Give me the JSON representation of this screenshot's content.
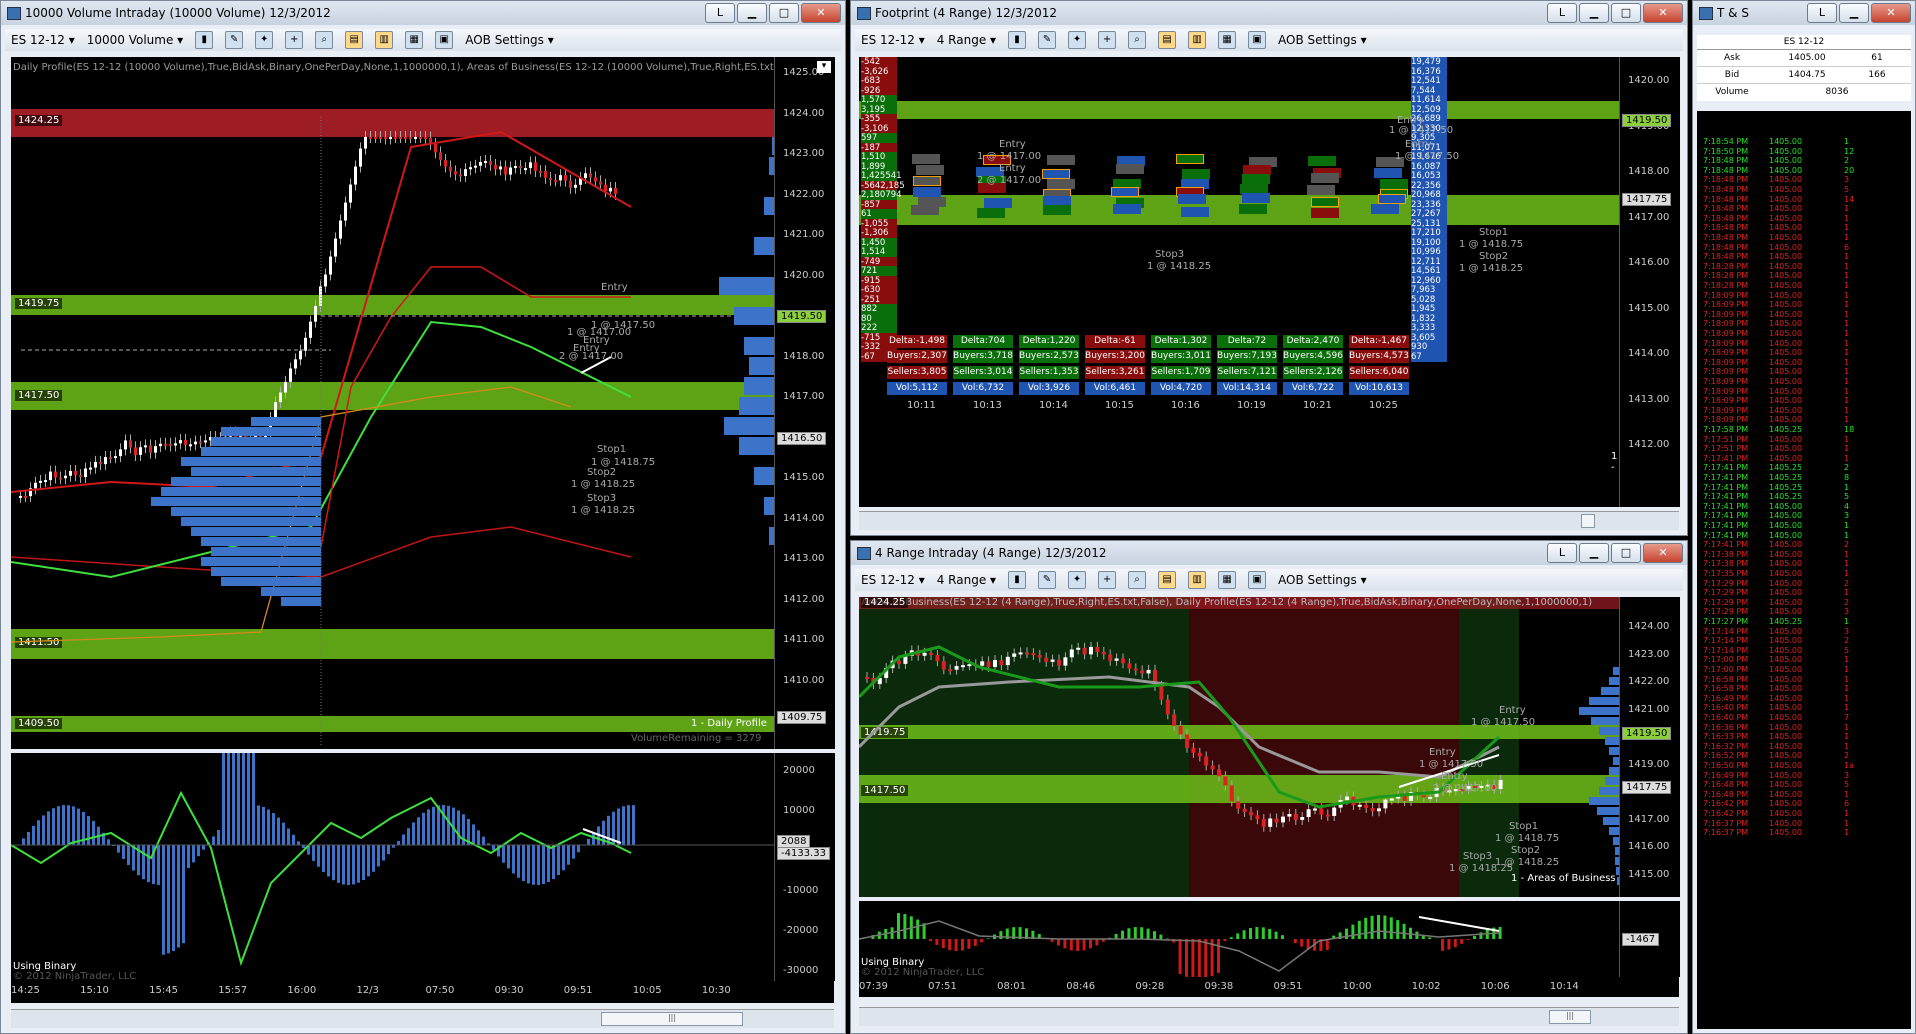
{
  "win1": {
    "title": "10000 Volume Intraday (10000 Volume)  12/3/2012",
    "instrument": "ES 12-12",
    "period": "10000 Volume",
    "aob": "AOB Settings",
    "indicator_text": "Daily Profile(ES 12-12 (10000 Volume),True,BidAsk,Binary,OnePerDay,None,1,1000000,1), Areas of Business(ES 12-12 (10000 Volume),True,Right,ES.txt",
    "prices": [
      "1425.00",
      "1424.00",
      "1423.00",
      "1422.00",
      "1421.00",
      "1420.00",
      "1419.00",
      "1418.00",
      "1417.00",
      "1416.00",
      "1415.00",
      "1414.00",
      "1413.00",
      "1412.00",
      "1411.00",
      "1410.00",
      "1409.00"
    ],
    "levels": [
      "1424.25",
      "1419.75",
      "1417.50",
      "1411.50",
      "1409.50"
    ],
    "tags": [
      "1419.50",
      "1416.50",
      "1409.75"
    ],
    "daily_profile": "1 - Daily Profile",
    "volume_remaining": "VolumeRemaining = 3279",
    "annotations": [
      "Entry",
      "1 @ 1417.50",
      "Entry",
      "1 @ 1417.00",
      "Entry",
      "2 @ 1417.00",
      "Stop1",
      "1 @ 1418.75",
      "Stop2",
      "1 @ 1418.25",
      "Stop3",
      "1 @ 1418.25"
    ],
    "osc_axis": [
      "20000",
      "10000",
      "-10000",
      "-20000",
      "-30000"
    ],
    "osc_tags": [
      "2088",
      "-4133.33"
    ],
    "using_binary": "Using Binary",
    "copyright": "© 2012 NinjaTrader, LLC",
    "times": [
      "14:25",
      "15:10",
      "15:45",
      "15:57",
      "16:00",
      "12/3",
      "07:50",
      "09:30",
      "09:51",
      "10:05",
      "10:30"
    ]
  },
  "win2": {
    "title": "Footprint (4 Range)  12/3/2012",
    "instrument": "ES 12-12",
    "period": "4 Range",
    "aob": "AOB Settings",
    "prices": [
      "1420.00",
      "1419.00",
      "1418.00",
      "1417.00",
      "1416.00",
      "1415.00",
      "1414.00",
      "1413.00",
      "1412.00"
    ],
    "tags": [
      "1419.50",
      "1417.75"
    ],
    "left_col": [
      "-542",
      "-3,626",
      "-683",
      "-926",
      "1,570",
      "3,195",
      "-355",
      "-3,106",
      "597",
      "-187",
      "1,510",
      "1,899",
      "1,425541",
      "-5642,185",
      "2,180794",
      "-857 285",
      "61",
      "-1,055",
      "-1,306",
      "1,450",
      "1,514",
      "-749",
      "721",
      "-915",
      "-630",
      "-251",
      "882",
      "80",
      "222",
      "-715",
      "-332",
      "-67"
    ],
    "right_col": [
      "19,479",
      "16,376",
      "12,541",
      "7,544",
      "11,614",
      "12,509",
      "26,689",
      "12,330",
      "9,305",
      "11,071",
      "19,676",
      "16,087",
      "16,053",
      "22,356",
      "20,968",
      "23,336",
      "27,267",
      "25,131",
      "17,210",
      "19,100",
      "10,996",
      "12,711",
      "14,561",
      "12,960",
      "7,963",
      "5,028",
      "1,945",
      "1,832",
      "3,333",
      "3,605",
      "930",
      "67"
    ],
    "annotations": [
      "Entry",
      "1 @ 1417.00",
      "Entry",
      "2 @ 1417.00",
      "Stop3",
      "1 @ 1418.25",
      "Entry",
      "1 @ 1417.50",
      "Entry",
      "1 @ 1417.50",
      "Stop1",
      "1 @ 1418.75",
      "Stop2",
      "1 @ 1418.25"
    ],
    "deltas": [
      "Delta:-1,498",
      "Delta:704",
      "Delta:1,220",
      "Delta:-61",
      "Delta:1,302",
      "Delta:72",
      "Delta:2,470",
      "Delta:-1,467"
    ],
    "buyers": [
      "Buyers:2,307",
      "Buyers:3,718",
      "Buyers:2,573",
      "Buyers:3,200",
      "Buyers:3,011",
      "Buyers:7,193",
      "Buyers:4,596",
      "Buyers:4,573"
    ],
    "sellers": [
      "Sellers:3,805",
      "Sellers:3,014",
      "Sellers:1,353",
      "Sellers:3,261",
      "Sellers:1,709",
      "Sellers:7,121",
      "Sellers:2,126",
      "Sellers:6,040"
    ],
    "vols": [
      "Vol:5,112",
      "Vol:6,732",
      "Vol:3,926",
      "Vol:6,461",
      "Vol:4,720",
      "Vol:14,314",
      "Vol:6,722",
      "Vol:10,613"
    ],
    "times": [
      "10:11",
      "10:13",
      "10:14",
      "10:15",
      "10:16",
      "10:19",
      "10:21",
      "10:25"
    ],
    "page": "1 -"
  },
  "win3": {
    "title": "4 Range Intraday (4 Range)  12/3/2012",
    "instrument": "ES 12-12",
    "period": "4 Range",
    "aob": "AOB Settings",
    "indicator_text": "Areas of Business(ES 12-12 (4 Range),True,Right,ES.txt,False), Daily Profile(ES 12-12 (4 Range),True,BidAsk,Binary,OnePerDay,None,1,1000000,1)",
    "prices": [
      "1424.00",
      "1423.00",
      "1422.00",
      "1421.00",
      "1420.00",
      "1419.00",
      "1418.00",
      "1417.00",
      "1416.00",
      "1415.00"
    ],
    "levels": [
      "1424.25",
      "1419.75",
      "1417.50"
    ],
    "tags": [
      "1419.50",
      "1417.75",
      "-1467"
    ],
    "annotations": [
      "Entry",
      "1 @ 1417.50",
      "Entry",
      "1 @ 1417.50",
      "Entry",
      "2 @ 1417.00",
      "Stop1",
      "1 @ 1418.75",
      "Stop2",
      "1 @ 1418.25",
      "Stop3",
      "1 @ 1418.25"
    ],
    "areas": "1 - Areas of Business",
    "using_binary": "Using Binary",
    "copyright": "© 2012 NinjaTrader, LLC",
    "times": [
      "07:39",
      "07:51",
      "08:01",
      "08:46",
      "09:28",
      "09:38",
      "09:51",
      "10:00",
      "10:02",
      "10:06",
      "10:14"
    ]
  },
  "ts": {
    "title": "T & S",
    "instrument": "ES 12-12",
    "ask_label": "Ask",
    "ask_price": "1405.00",
    "ask_size": "61",
    "bid_label": "Bid",
    "bid_price": "1404.75",
    "bid_size": "166",
    "vol_label": "Volume",
    "vol_value": "8036",
    "rows": [
      {
        "t": "7:18:54 PM",
        "p": "1405.00",
        "s": "1",
        "c": "g"
      },
      {
        "t": "7:18:50 PM",
        "p": "1405.00",
        "s": "12",
        "c": "g"
      },
      {
        "t": "7:18:48 PM",
        "p": "1405.00",
        "s": "2",
        "c": "g"
      },
      {
        "t": "7:18:48 PM",
        "p": "1405.00",
        "s": "20",
        "c": "g"
      },
      {
        "t": "7:18:48 PM",
        "p": "1405.00",
        "s": "3",
        "c": "r"
      },
      {
        "t": "7:18:48 PM",
        "p": "1405.00",
        "s": "5",
        "c": "r"
      },
      {
        "t": "7:18:48 PM",
        "p": "1405.00",
        "s": "14",
        "c": "r"
      },
      {
        "t": "7:18:48 PM",
        "p": "1405.00",
        "s": "1",
        "c": "r"
      },
      {
        "t": "7:18:48 PM",
        "p": "1405.00",
        "s": "1",
        "c": "r"
      },
      {
        "t": "7:18:48 PM",
        "p": "1405.00",
        "s": "1",
        "c": "r"
      },
      {
        "t": "7:18:48 PM",
        "p": "1405.00",
        "s": "1",
        "c": "r"
      },
      {
        "t": "7:18:48 PM",
        "p": "1405.00",
        "s": "6",
        "c": "r"
      },
      {
        "t": "7:18:48 PM",
        "p": "1405.00",
        "s": "1",
        "c": "r"
      },
      {
        "t": "7:18:28 PM",
        "p": "1405.00",
        "s": "1",
        "c": "r"
      },
      {
        "t": "7:18:28 PM",
        "p": "1405.00",
        "s": "1",
        "c": "r"
      },
      {
        "t": "7:18:28 PM",
        "p": "1405.00",
        "s": "1",
        "c": "r"
      },
      {
        "t": "7:18:09 PM",
        "p": "1405.00",
        "s": "1",
        "c": "r"
      },
      {
        "t": "7:18:09 PM",
        "p": "1405.00",
        "s": "1",
        "c": "r"
      },
      {
        "t": "7:18:09 PM",
        "p": "1405.00",
        "s": "1",
        "c": "r"
      },
      {
        "t": "7:18:09 PM",
        "p": "1405.00",
        "s": "1",
        "c": "r"
      },
      {
        "t": "7:18:09 PM",
        "p": "1405.00",
        "s": "1",
        "c": "r"
      },
      {
        "t": "7:18:09 PM",
        "p": "1405.00",
        "s": "1",
        "c": "r"
      },
      {
        "t": "7:18:09 PM",
        "p": "1405.00",
        "s": "1",
        "c": "r"
      },
      {
        "t": "7:18:09 PM",
        "p": "1405.00",
        "s": "1",
        "c": "r"
      },
      {
        "t": "7:18:09 PM",
        "p": "1405.00",
        "s": "1",
        "c": "r"
      },
      {
        "t": "7:18:09 PM",
        "p": "1405.00",
        "s": "1",
        "c": "r"
      },
      {
        "t": "7:18:09 PM",
        "p": "1405.00",
        "s": "1",
        "c": "r"
      },
      {
        "t": "7:18:09 PM",
        "p": "1405.00",
        "s": "1",
        "c": "r"
      },
      {
        "t": "7:18:09 PM",
        "p": "1405.00",
        "s": "1",
        "c": "r"
      },
      {
        "t": "7:18:09 PM",
        "p": "1405.00",
        "s": "1",
        "c": "r"
      },
      {
        "t": "7:17:58 PM",
        "p": "1405.25",
        "s": "18",
        "c": "g"
      },
      {
        "t": "7:17:51 PM",
        "p": "1405.00",
        "s": "1",
        "c": "r"
      },
      {
        "t": "7:17:51 PM",
        "p": "1405.00",
        "s": "1",
        "c": "r"
      },
      {
        "t": "7:17:41 PM",
        "p": "1405.00",
        "s": "1",
        "c": "r"
      },
      {
        "t": "7:17:41 PM",
        "p": "1405.25",
        "s": "2",
        "c": "g"
      },
      {
        "t": "7:17:41 PM",
        "p": "1405.25",
        "s": "8",
        "c": "g"
      },
      {
        "t": "7:17:41 PM",
        "p": "1405.25",
        "s": "1",
        "c": "g"
      },
      {
        "t": "7:17:41 PM",
        "p": "1405.25",
        "s": "5",
        "c": "g"
      },
      {
        "t": "7:17:41 PM",
        "p": "1405.00",
        "s": "4",
        "c": "g"
      },
      {
        "t": "7:17:41 PM",
        "p": "1405.00",
        "s": "3",
        "c": "g"
      },
      {
        "t": "7:17:41 PM",
        "p": "1405.00",
        "s": "1",
        "c": "g"
      },
      {
        "t": "7:17:41 PM",
        "p": "1405.00",
        "s": "1",
        "c": "g"
      },
      {
        "t": "7:17:41 PM",
        "p": "1405.00",
        "s": "2",
        "c": "r"
      },
      {
        "t": "7:17:38 PM",
        "p": "1405.00",
        "s": "1",
        "c": "r"
      },
      {
        "t": "7:17:38 PM",
        "p": "1405.00",
        "s": "1",
        "c": "r"
      },
      {
        "t": "7:17:35 PM",
        "p": "1405.00",
        "s": "1",
        "c": "r"
      },
      {
        "t": "7:17:29 PM",
        "p": "1405.00",
        "s": "2",
        "c": "r"
      },
      {
        "t": "7:17:29 PM",
        "p": "1405.00",
        "s": "1",
        "c": "r"
      },
      {
        "t": "7:17:29 PM",
        "p": "1405.00",
        "s": "2",
        "c": "r"
      },
      {
        "t": "7:17:29 PM",
        "p": "1405.00",
        "s": "3",
        "c": "r"
      },
      {
        "t": "7:17:27 PM",
        "p": "1405.25",
        "s": "1",
        "c": "g"
      },
      {
        "t": "7:17:14 PM",
        "p": "1405.00",
        "s": "3",
        "c": "r"
      },
      {
        "t": "7:17:14 PM",
        "p": "1405.00",
        "s": "2",
        "c": "r"
      },
      {
        "t": "7:17:14 PM",
        "p": "1405.00",
        "s": "5",
        "c": "r"
      },
      {
        "t": "7:17:00 PM",
        "p": "1405.00",
        "s": "1",
        "c": "r"
      },
      {
        "t": "7:17:00 PM",
        "p": "1405.00",
        "s": "1",
        "c": "r"
      },
      {
        "t": "7:16:58 PM",
        "p": "1405.00",
        "s": "1",
        "c": "r"
      },
      {
        "t": "7:16:58 PM",
        "p": "1405.00",
        "s": "1",
        "c": "r"
      },
      {
        "t": "7:16:49 PM",
        "p": "1405.00",
        "s": "1",
        "c": "r"
      },
      {
        "t": "7:16:40 PM",
        "p": "1405.00",
        "s": "1",
        "c": "r"
      },
      {
        "t": "7:16:40 PM",
        "p": "1405.00",
        "s": "7",
        "c": "r"
      },
      {
        "t": "7:16:36 PM",
        "p": "1405.00",
        "s": "1",
        "c": "r"
      },
      {
        "t": "7:16:33 PM",
        "p": "1405.00",
        "s": "1",
        "c": "r"
      },
      {
        "t": "7:16:32 PM",
        "p": "1405.00",
        "s": "1",
        "c": "r"
      },
      {
        "t": "7:16:52 PM",
        "p": "1405.00",
        "s": "2",
        "c": "r"
      },
      {
        "t": "7:16:50 PM",
        "p": "1405.00",
        "s": "1a",
        "c": "r"
      },
      {
        "t": "7:16:49 PM",
        "p": "1405.00",
        "s": "3",
        "c": "r"
      },
      {
        "t": "7:16:48 PM",
        "p": "1405.00",
        "s": "5",
        "c": "r"
      },
      {
        "t": "7:16:48 PM",
        "p": "1405.00",
        "s": "1",
        "c": "r"
      },
      {
        "t": "7:16:42 PM",
        "p": "1405.00",
        "s": "6",
        "c": "r"
      },
      {
        "t": "7:16:42 PM",
        "p": "1405.00",
        "s": "1",
        "c": "r"
      },
      {
        "t": "7:16:37 PM",
        "p": "1405.00",
        "s": "1",
        "c": "r"
      },
      {
        "t": "7:16:37 PM",
        "p": "1405.00",
        "s": "1",
        "c": "r"
      }
    ]
  },
  "colors": {
    "green_band": "#6fc01a",
    "red_band": "#9e1d24",
    "up": "#ffffff",
    "down": "#e02020",
    "profile": "#3d74c9"
  }
}
